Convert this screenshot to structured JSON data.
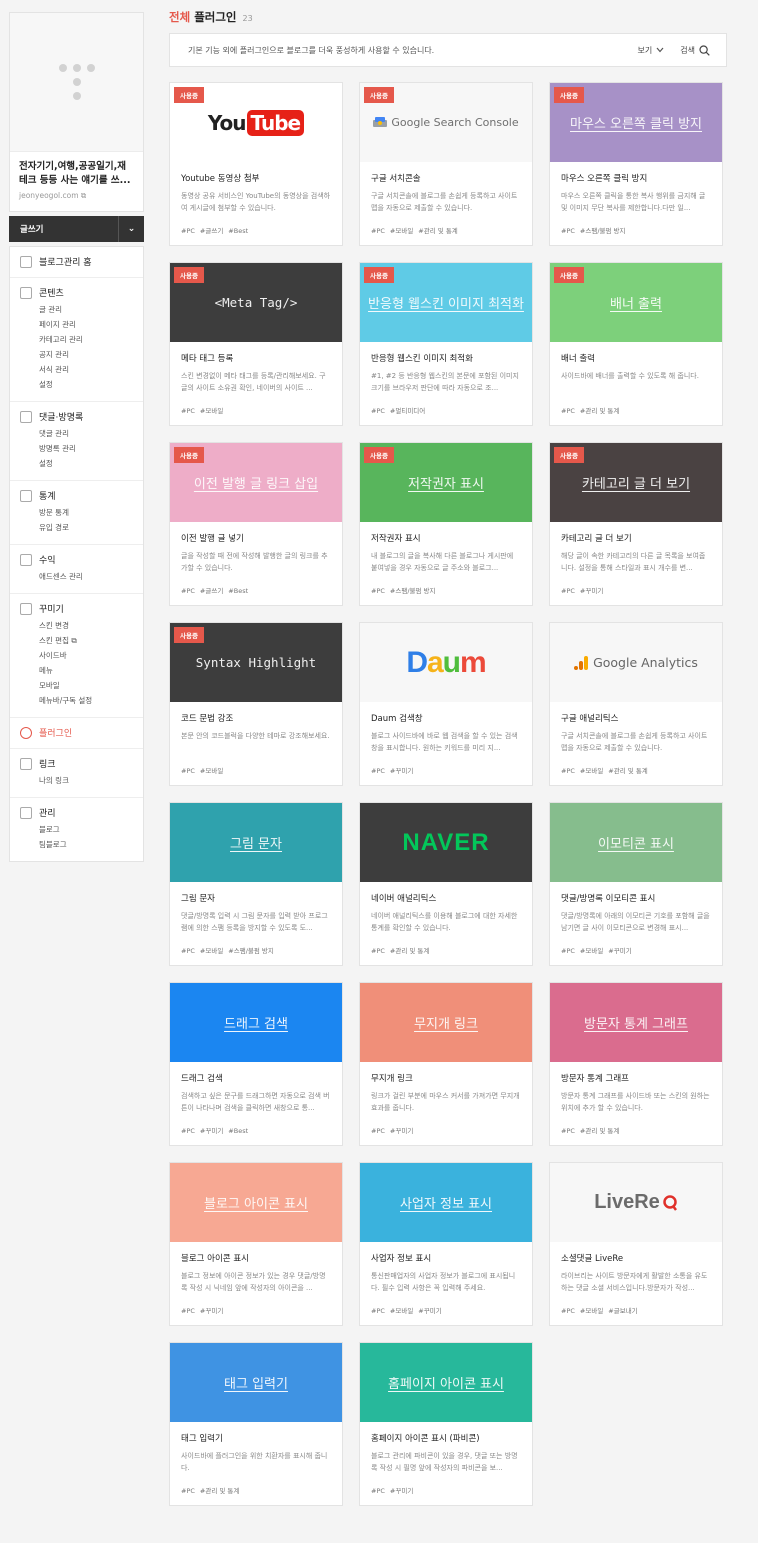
{
  "sidebar": {
    "blog_title": "전자기기,여행,공공일기,재테크 등등 사는 얘기를 쓰...",
    "blog_url": "jeonyeogol.com",
    "write_button": "글쓰기",
    "sections": [
      {
        "label": "블로그관리 홈",
        "icon": "home-icon",
        "items": []
      },
      {
        "label": "콘텐츠",
        "icon": "document-icon",
        "items": [
          "글 관리",
          "페이지 관리",
          "카테고리 관리",
          "공지 관리",
          "서식 관리",
          "설정"
        ]
      },
      {
        "label": "댓글·방명록",
        "icon": "comment-icon",
        "items": [
          "댓글 관리",
          "방명록 관리",
          "설정"
        ]
      },
      {
        "label": "통계",
        "icon": "chart-icon",
        "items": [
          "방문 통계",
          "유입 경로"
        ]
      },
      {
        "label": "수익",
        "icon": "money-icon",
        "items": [
          "애드센스 관리"
        ]
      },
      {
        "label": "꾸미기",
        "icon": "layout-icon",
        "items": [
          "스킨 변경",
          "스킨 편집",
          "사이드바",
          "메뉴",
          "모바일",
          "메뉴바/구독 설정"
        ]
      },
      {
        "label": "플러그인",
        "icon": "plugin-icon",
        "items": [],
        "active": true
      },
      {
        "label": "링크",
        "icon": "link-icon",
        "items": [
          "나의 링크"
        ]
      },
      {
        "label": "관리",
        "icon": "gear-icon",
        "items": [
          "블로그",
          "팀블로그"
        ]
      }
    ]
  },
  "header": {
    "title_highlight": "전체",
    "title_rest": "플러그인",
    "count": "23",
    "notice": "기본 기능 외에 플러그인으로 블로그를 더욱 풍성하게 사용할 수 있습니다.",
    "view_label": "보기",
    "search_label": "검색"
  },
  "colors": {
    "accent": "#e5584b"
  },
  "plugins": [
    {
      "title": "Youtube 동영상 첨부",
      "desc": "동영상 공유 서비스인 YouTube의 동영상을 검색하여 게시글에 첨부할 수 있습니다.",
      "tags": [
        "#PC",
        "#글쓰기",
        "#Best"
      ],
      "badge": "사용중",
      "thumb_text": "You Tube",
      "thumb_bg": "#ffffff",
      "logo": "youtube"
    },
    {
      "title": "구글 서치콘솔",
      "desc": "구글 서치콘솔에 블로그를 손쉽게 등록하고 사이트맵을 자동으로 제출할 수 있습니다.",
      "tags": [
        "#PC",
        "#모바일",
        "#관리 및 통계"
      ],
      "badge": "사용중",
      "thumb_text": "Google Search Console",
      "thumb_bg": "#f7f7f7",
      "logo": "gsc"
    },
    {
      "title": "마우스 오른쪽 클릭 방지",
      "desc": "마우스 오른쪽 클릭을 통한 복사 행위를 금지해 글 및 이미지 무단 복사를 제한합니다.다만 일...",
      "tags": [
        "#PC",
        "#스팸/불펌 방지"
      ],
      "badge": "사용중",
      "thumb_text": "마우스 오른쪽 클릭 방지",
      "thumb_bg": "#a791c7",
      "logo": "text"
    },
    {
      "title": "메타 태그 등록",
      "desc": "스킨 변경없이 메타 태그를 등록/관리해보세요. 구글의 사이트 소유권 확인, 네이버의 사이트 ...",
      "tags": [
        "#PC",
        "#모바일"
      ],
      "badge": "사용중",
      "thumb_text": "<Meta Tag/>",
      "thumb_bg": "#3d3d3d",
      "logo": "mono"
    },
    {
      "title": "반응형 웹스킨 이미지 최적화",
      "desc": "#1, #2 등 반응형 웹스킨의 본문에 포함된 이미지 크기를 브라우저 판단에 따라 자동으로 조...",
      "tags": [
        "#PC",
        "#멀티미디어"
      ],
      "badge": "사용중",
      "thumb_text": "반응형 웹스킨 이미지 최적화",
      "thumb_bg": "#5fcbe6",
      "logo": "text"
    },
    {
      "title": "배너 출력",
      "desc": "사이드바에 배너를 출력할 수 있도록 해 줍니다.",
      "tags": [
        "#PC",
        "#관리 및 통계"
      ],
      "badge": "사용중",
      "thumb_text": "배너 출력",
      "thumb_bg": "#7dd07b",
      "logo": "text"
    },
    {
      "title": "이전 발행 글 넣기",
      "desc": "글을 작성할 때 전에 작성해 발행한 글의 링크를 추가할 수 있습니다.",
      "tags": [
        "#PC",
        "#글쓰기",
        "#Best"
      ],
      "badge": "사용중",
      "thumb_text": "이전 발행 글 링크 삽입",
      "thumb_bg": "#eeadc8",
      "logo": "text"
    },
    {
      "title": "저작권자 표시",
      "desc": "내 블로그의 글을 복사해 다른 블로그나 게시판에 붙여넣을 경우 자동으로 글 주소와 블로그...",
      "tags": [
        "#PC",
        "#스팸/불펌 방지"
      ],
      "badge": "사용중",
      "thumb_text": "저작권자 표시",
      "thumb_bg": "#58b55c",
      "logo": "text"
    },
    {
      "title": "카테고리 글 더 보기",
      "desc": "해당 글이 속한 카테고리의 다른 글 목록을 보여줍니다. 설정을 통해 스타일과 표시 개수를 변...",
      "tags": [
        "#PC",
        "#꾸미기"
      ],
      "badge": "사용중",
      "thumb_text": "카테고리 글 더 보기",
      "thumb_bg": "#4a4242",
      "logo": "text"
    },
    {
      "title": "코드 문법 강조",
      "desc": "본문 안의 코드블럭을 다양한 테마로 강조해보세요.",
      "tags": [
        "#PC",
        "#모바일"
      ],
      "badge": "사용중",
      "thumb_text": "Syntax Highlight",
      "thumb_bg": "#3d3d3d",
      "logo": "mono"
    },
    {
      "title": "Daum 검색창",
      "desc": "블로그 사이드바에 바로 웹 검색을 할 수 있는 검색창을 표시합니다. 원하는 키워드를 미리 지...",
      "tags": [
        "#PC",
        "#꾸미기"
      ],
      "badge": "",
      "thumb_text": "Daum",
      "thumb_bg": "#f7f7f7",
      "logo": "daum"
    },
    {
      "title": "구글 애널리틱스",
      "desc": "구글 서치콘솔에 블로그를 손쉽게 등록하고 사이트맵을 자동으로 제출할 수 있습니다.",
      "tags": [
        "#PC",
        "#모바일",
        "#관리 및 통계"
      ],
      "badge": "",
      "thumb_text": "Google Analytics",
      "thumb_bg": "#f7f7f7",
      "logo": "ga"
    },
    {
      "title": "그림 문자",
      "desc": "댓글/방명록 입력 시 그림 문자를 입력 받아 프로그램에 의한 스팸 등록을 방지할 수 있도록 도...",
      "tags": [
        "#PC",
        "#모바일",
        "#스팸/불펌 방지"
      ],
      "badge": "",
      "thumb_text": "그림 문자",
      "thumb_bg": "#2fa2ad",
      "logo": "text"
    },
    {
      "title": "네이버 애널리틱스",
      "desc": "네이버 애널리틱스를 이용해 블로그에 대한 자세한 통계를 확인할 수 있습니다.",
      "tags": [
        "#PC",
        "#관리 및 통계"
      ],
      "badge": "",
      "thumb_text": "NAVER",
      "thumb_bg": "#3d3d3d",
      "logo": "naver"
    },
    {
      "title": "댓글/방명록 이모티콘 표시",
      "desc": "댓글/방명록에 아래의 이모티콘 기호를 포함해 글을 남기면 글 사이 이모티콘으로 변경해 표시...",
      "tags": [
        "#PC",
        "#모바일",
        "#꾸미기"
      ],
      "badge": "",
      "thumb_text": "이모티콘 표시",
      "thumb_bg": "#86bd8d",
      "logo": "text"
    },
    {
      "title": "드래그 검색",
      "desc": "검색하고 싶은 문구를 드래그하면 자동으로 검색 버튼이 나타나며 검색을 클릭하면 새창으로 통...",
      "tags": [
        "#PC",
        "#꾸미기",
        "#Best"
      ],
      "badge": "",
      "thumb_text": "드래그 검색",
      "thumb_bg": "#1b86f1",
      "logo": "text"
    },
    {
      "title": "무지개 링크",
      "desc": "링크가 걸린 부분에 마우스 커서를 가져가면 무지개 효과를 줍니다.",
      "tags": [
        "#PC",
        "#꾸미기"
      ],
      "badge": "",
      "thumb_text": "무지개 링크",
      "thumb_bg": "#f08f79",
      "logo": "text"
    },
    {
      "title": "방문자 통계 그래프",
      "desc": "방문자 통계 그래프를 사이드바 또는 스킨의 원하는 위치에 추가 할 수 있습니다.",
      "tags": [
        "#PC",
        "#관리 및 통계"
      ],
      "badge": "",
      "thumb_text": "방문자 통계 그래프",
      "thumb_bg": "#da6c8e",
      "logo": "text"
    },
    {
      "title": "블로그 아이콘 표시",
      "desc": "블로그 정보에 아이콘 정보가 있는 경우 댓글/방명록 작성 시 닉네임 앞에 작성자의 아이콘을 ...",
      "tags": [
        "#PC",
        "#꾸미기"
      ],
      "badge": "",
      "thumb_text": "블로그 아이콘 표시",
      "thumb_bg": "#f7a893",
      "logo": "text"
    },
    {
      "title": "사업자 정보 표시",
      "desc": "통신판매업자의 사업자 정보가 블로그에 표시됩니다. 필수 입력 사항은 꼭 입력해 주세요.",
      "tags": [
        "#PC",
        "#모바일",
        "#꾸미기"
      ],
      "badge": "",
      "thumb_text": "사업자 정보 표시",
      "thumb_bg": "#3ab2dd",
      "logo": "text"
    },
    {
      "title": "소셜댓글 LiveRe",
      "desc": "라이브리는 사이트 방문자에게 활발한 소통을 유도하는 댓글 소셜 서비스입니다.방문자가 작성...",
      "tags": [
        "#PC",
        "#모바일",
        "#글보내기"
      ],
      "badge": "",
      "thumb_text": "LiveRe",
      "thumb_bg": "#f7f7f7",
      "logo": "livere"
    },
    {
      "title": "태그 입력기",
      "desc": "사이드바에 플러그인을 위한 치환자를 표시해 줍니다.",
      "tags": [
        "#PC",
        "#관리 및 통계"
      ],
      "badge": "",
      "thumb_text": "태그 입력기",
      "thumb_bg": "#3f93e3",
      "logo": "text"
    },
    {
      "title": "홈페이지 아이콘 표시 (파비콘)",
      "desc": "블로그 관리에 파비콘이 있을 경우, 댓글 또는 방명록 작성 시 필명 앞에 작성자의 파비콘을 보...",
      "tags": [
        "#PC",
        "#꾸미기"
      ],
      "badge": "",
      "thumb_text": "홈페이지 아이콘 표시",
      "thumb_bg": "#27b89b",
      "logo": "text"
    }
  ]
}
